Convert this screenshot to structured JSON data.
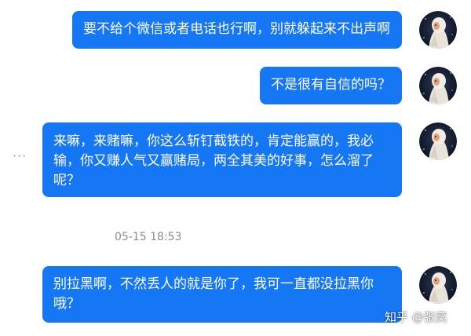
{
  "colors": {
    "bubble": "#1677f5",
    "bubble_text": "#ffffff",
    "meta_text": "#8c8c8c"
  },
  "messages": [
    {
      "text": "要不给个微信或者电话也行啊，别就躲起来不出声啊"
    },
    {
      "text": "不是很有自信的吗？"
    },
    {
      "text": "来嘛，来赌嘛，你这么斩钉截铁的，肯定能赢的，我必输，你又赚人气又赢赌局，两全其美的好事，怎么溜了呢？"
    },
    {
      "text": "别拉黑啊，不然丢人的就是你了，我可一直都没拉黑你哦？"
    }
  ],
  "more_options": {
    "label": "···",
    "icon": "more-dots-icon"
  },
  "timestamp": "05-15 18:53",
  "watermark": "知乎 @张奕",
  "avatar": {
    "icon": "dark-starry-portrait-avatar"
  }
}
